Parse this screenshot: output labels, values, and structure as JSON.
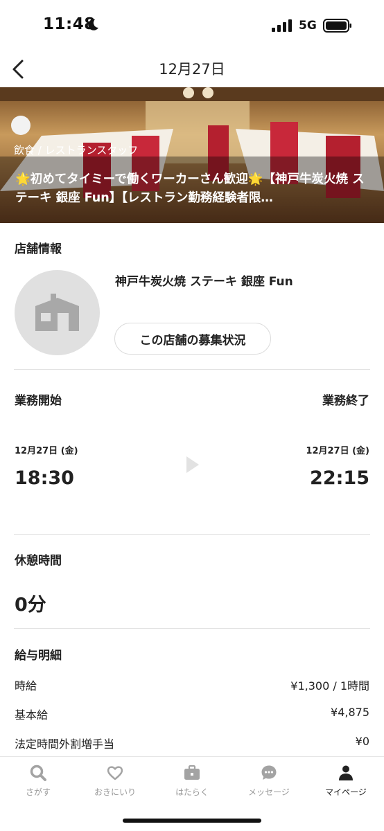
{
  "status": {
    "time": "11:48",
    "network": "5G"
  },
  "nav": {
    "title": "12月27日"
  },
  "hero": {
    "category": "飲食 / レストランスタッフ",
    "title_star": "🌟",
    "title_part1": "初めてタイミーで働くワーカーさん歓迎",
    "title_part2": "【神戸牛炭火焼 ステーキ 銀座 Fun】【レストラン勤務経験者限…"
  },
  "store": {
    "section_title": "店舗情報",
    "name": "神戸牛炭火焼 ステーキ 銀座 Fun",
    "status_button": "この店舗の募集状況"
  },
  "work": {
    "start_label": "業務開始",
    "end_label": "業務終了",
    "start_date": "12月27日 (金)",
    "end_date": "12月27日 (金)",
    "start_time": "18:30",
    "end_time": "22:15"
  },
  "break_time": {
    "label": "休憩時間",
    "value": "0分"
  },
  "pay": {
    "section_title": "給与明細",
    "rows": [
      {
        "label": "時給",
        "value": "¥1,300 / 1時間"
      },
      {
        "label": "基本給",
        "value": "¥4,875"
      },
      {
        "label": "法定時間外割増手当",
        "value": "¥0"
      }
    ]
  },
  "tabs": [
    {
      "label": "さがす",
      "icon": "search-icon"
    },
    {
      "label": "おきにいり",
      "icon": "heart-icon"
    },
    {
      "label": "はたらく",
      "icon": "briefcase-icon"
    },
    {
      "label": "メッセージ",
      "icon": "chat-icon"
    },
    {
      "label": "マイページ",
      "icon": "person-icon",
      "active": true
    }
  ],
  "colors": {
    "inactive_tab": "#9a9a9a",
    "active_tab": "#222222",
    "divider": "#e3e3e3",
    "hero_wall": "#d8b27a",
    "hero_seat": "#c8283a"
  }
}
